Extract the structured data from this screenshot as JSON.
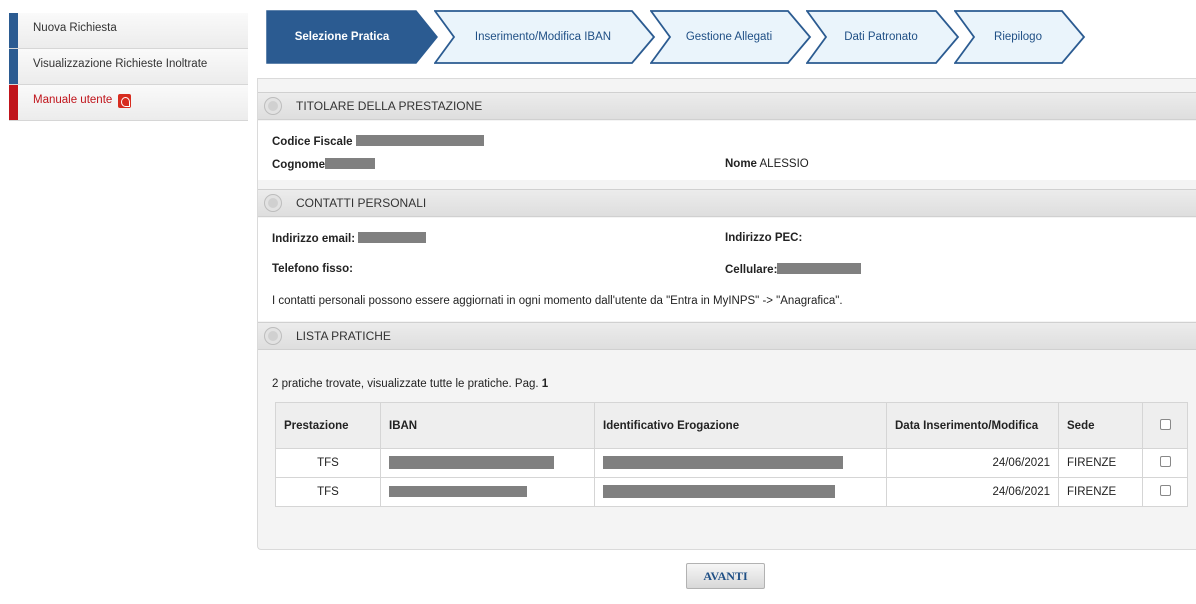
{
  "sidebar": {
    "items": [
      {
        "label": "Nuova Richiesta"
      },
      {
        "label": "Visualizzazione Richieste Inoltrate"
      },
      {
        "label": "Manuale utente",
        "icon": "pdf-icon"
      }
    ]
  },
  "wizard": {
    "steps": [
      {
        "label": "Selezione Pratica",
        "active": true
      },
      {
        "label": "Inserimento/Modifica IBAN",
        "active": false
      },
      {
        "label": "Gestione Allegati",
        "active": false
      },
      {
        "label": "Dati Patronato",
        "active": false
      },
      {
        "label": "Riepilogo",
        "active": false
      }
    ]
  },
  "titolare": {
    "title": "TITOLARE DELLA PRESTAZIONE",
    "codice_fiscale_label": "Codice Fiscale",
    "cognome_label": "Cognome",
    "nome_label": "Nome",
    "nome_value": "ALESSIO"
  },
  "contatti": {
    "title": "CONTATTI PERSONALI",
    "email_label": "Indirizzo email:",
    "pec_label": "Indirizzo PEC:",
    "telefono_label": "Telefono fisso:",
    "cellulare_label": "Cellulare:",
    "note": "I contatti personali possono essere aggiornati in ogni momento dall'utente da \"Entra in MyINPS\" -> \"Anagrafica\"."
  },
  "pratiche": {
    "title": "LISTA PRATICHE",
    "summary": "2 pratiche trovate, visualizzate tutte le pratiche. Pag.",
    "page": "1",
    "columns": [
      "Prestazione",
      "IBAN",
      "Identificativo Erogazione",
      "Data Inserimento/Modifica",
      "Sede"
    ],
    "rows": [
      {
        "prestazione": "TFS",
        "data": "24/06/2021",
        "sede": "FIRENZE"
      },
      {
        "prestazione": "TFS",
        "data": "24/06/2021",
        "sede": "FIRENZE"
      }
    ]
  },
  "actions": {
    "next_label": "AVANTI"
  },
  "colors": {
    "primary": "#2b5b91",
    "step_inactive_fill": "#eaf4fb",
    "accent_red": "#c0141b"
  }
}
